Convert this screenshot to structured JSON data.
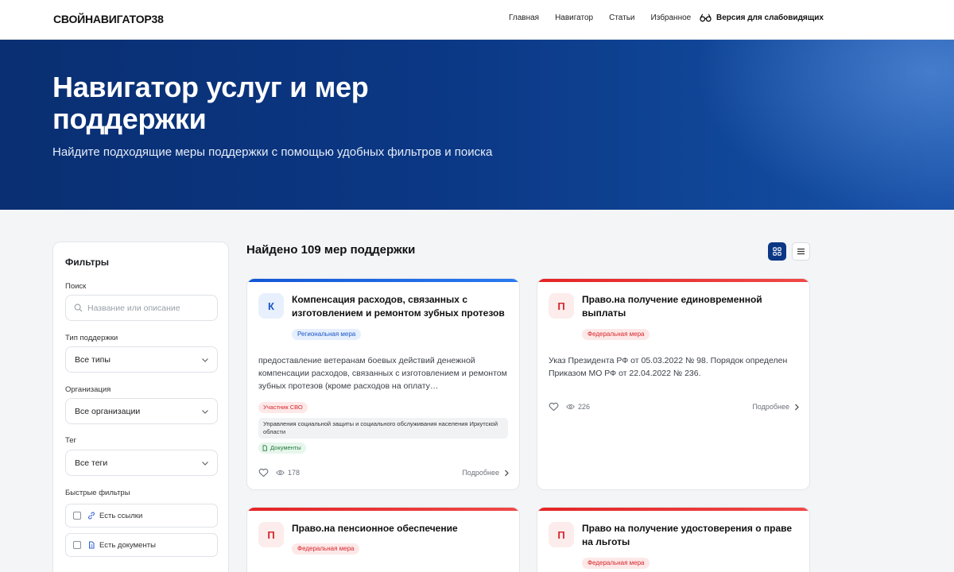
{
  "header": {
    "logo": "СВОЙНАВИГАТОР38",
    "nav": [
      "Главная",
      "Навигатор",
      "Статьи",
      "Избранное"
    ],
    "a11y": "Версия для слабовидящих"
  },
  "hero": {
    "title": "Навигатор услуг и мер поддержки",
    "subtitle": "Найдите подходящие меры поддержки с помощью удобных фильтров и поиска"
  },
  "filters": {
    "title": "Фильтры",
    "search_label": "Поиск",
    "search_placeholder": "Название или описание",
    "type_label": "Тип поддержки",
    "type_value": "Все типы",
    "org_label": "Организация",
    "org_value": "Все организации",
    "tag_label": "Тег",
    "tag_value": "Все теги",
    "quick_label": "Быстрые фильтры",
    "quick_links": "Есть ссылки",
    "quick_docs": "Есть документы"
  },
  "results": {
    "found": "Найдено 109 мер поддержки"
  },
  "cards": [
    {
      "letter": "К",
      "title": "Компенсация расходов, связанных с изготовлением и ремонтом зубных протезов",
      "kind": "Региональная мера",
      "description": "предоставление ветеранам боевых действий денежной компенсации расходов, связанных с изготовлением и ремонтом зубных протезов (кроме расходов на оплату…",
      "participant": "Участник СВО",
      "org": "Управления социальной защиты и социального обслуживания населения Иркутской области",
      "docs": "Документы",
      "views": "178",
      "more": "Подробнее"
    },
    {
      "letter": "П",
      "title": "Право.на получение единовременной выплаты",
      "kind": "Федеральная мера",
      "description": "Указ Президента РФ от 05.03.2022 № 98. Порядок определен Приказом МО РФ от 22.04.2022 № 236.",
      "views": "226",
      "more": "Подробнее"
    },
    {
      "letter": "П",
      "title": "Право.на пенсионное обеспечение",
      "kind": "Федеральная мера"
    },
    {
      "letter": "П",
      "title": "Право на получение удостоверения о праве на льготы",
      "kind": "Федеральная мера"
    }
  ],
  "colors": {
    "brand_dark": "#0b3784",
    "regional": "#1a57c8",
    "federal": "#d7262b"
  },
  "icons": [
    "glasses-icon",
    "search-icon",
    "chevron-down-icon",
    "link-icon",
    "document-icon",
    "grid-view-icon",
    "list-view-icon",
    "heart-icon",
    "eye-icon",
    "chevron-right-icon"
  ]
}
